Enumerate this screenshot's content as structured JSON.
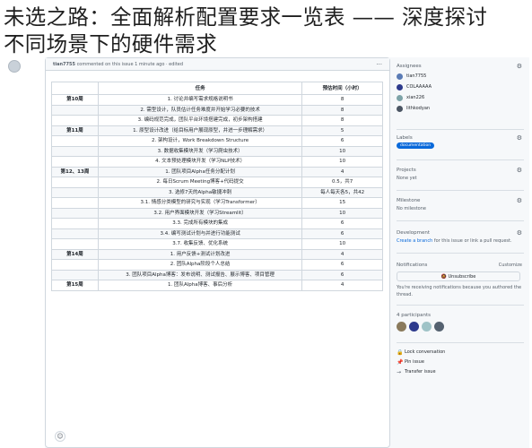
{
  "headline": {
    "line1": "未选之路：全面解析配置要求一览表 —— 深度探讨",
    "line2": "不同场景下的硬件需求"
  },
  "comment": {
    "author": "tian7755",
    "meta": "commented on this issue 1 minute ago · edited"
  },
  "table": {
    "headers": [
      "",
      "任务",
      "预估时间（小时）"
    ],
    "rows": [
      [
        "第10周",
        "1. 讨论并编写需求规格说明书",
        "8"
      ],
      [
        "",
        "2. 需型设计，队员估计任务难度并开始学习必要的技术",
        "8"
      ],
      [
        "",
        "3. 编码规范完成，团队平台环境搭建完成，初步架构搭建",
        "8"
      ],
      [
        "第11周",
        "1. 原型设计改进（给目标用户展现原型，并进一步理解需求）",
        "5"
      ],
      [
        "",
        "2. 架构设计，Work Breakdown Structure",
        "6"
      ],
      [
        "",
        "3. 数据收集模块开发（学习爬虫技术）",
        "10"
      ],
      [
        "",
        "4. 文本预处理模块开发（学习NLP技术）",
        "10"
      ],
      [
        "第12、13周",
        "1. 团队项目Alpha任务分配计划",
        "4"
      ],
      [
        "",
        "2. 每日Scrum Meeting博客+代码提交",
        "0.5，共7"
      ],
      [
        "",
        "3. 选修7天的Alpha敏捷冲刺",
        "每人每天各5，共42"
      ],
      [
        "",
        "3.1. 情感分类模型的研究与实现（学习Transformer）",
        "15"
      ],
      [
        "",
        "3.2. 用户界面模块开发（学习Streamlit）",
        "10"
      ],
      [
        "",
        "3.3. 完成所有模块的集成",
        "6"
      ],
      [
        "",
        "3.4. 编写测试计划与并进行功能测试",
        "6"
      ],
      [
        "",
        "3.7. 收集反馈、优化系统",
        "10"
      ],
      [
        "第14周",
        "1. 用户反馈+测试计划改进",
        "4"
      ],
      [
        "",
        "2. 团队Alpha阶段个人总结",
        "6"
      ],
      [
        "",
        "3. 团队项目Alpha博客：发布说明、测试报告、展示博客、项目管理",
        "6"
      ],
      [
        "第15周",
        "1. 团队Alpha博客、事后分析",
        "4"
      ]
    ]
  },
  "sidebar": {
    "assignees_title": "Assignees",
    "assignees": [
      "tian7755",
      "COLAAAAA",
      "xian226",
      "lithkodyan"
    ],
    "labels_title": "Labels",
    "label": "documentation",
    "projects_title": "Projects",
    "projects_value": "None yet",
    "milestone_title": "Milestone",
    "milestone_value": "No milestone",
    "development_title": "Development",
    "development_link": "Create a branch",
    "development_text": " for this issue or link a pull request.",
    "notifications_title": "Notifications",
    "customize": "Customize",
    "unsubscribe": "Unsubscribe",
    "notify_text": "You're receiving notifications because you authored the thread.",
    "participants_title": "4 participants",
    "actions": [
      "Lock conversation",
      "Pin issue",
      "Transfer issue"
    ]
  },
  "colors": {
    "accent": "#0969da",
    "border": "#d0d7de"
  }
}
